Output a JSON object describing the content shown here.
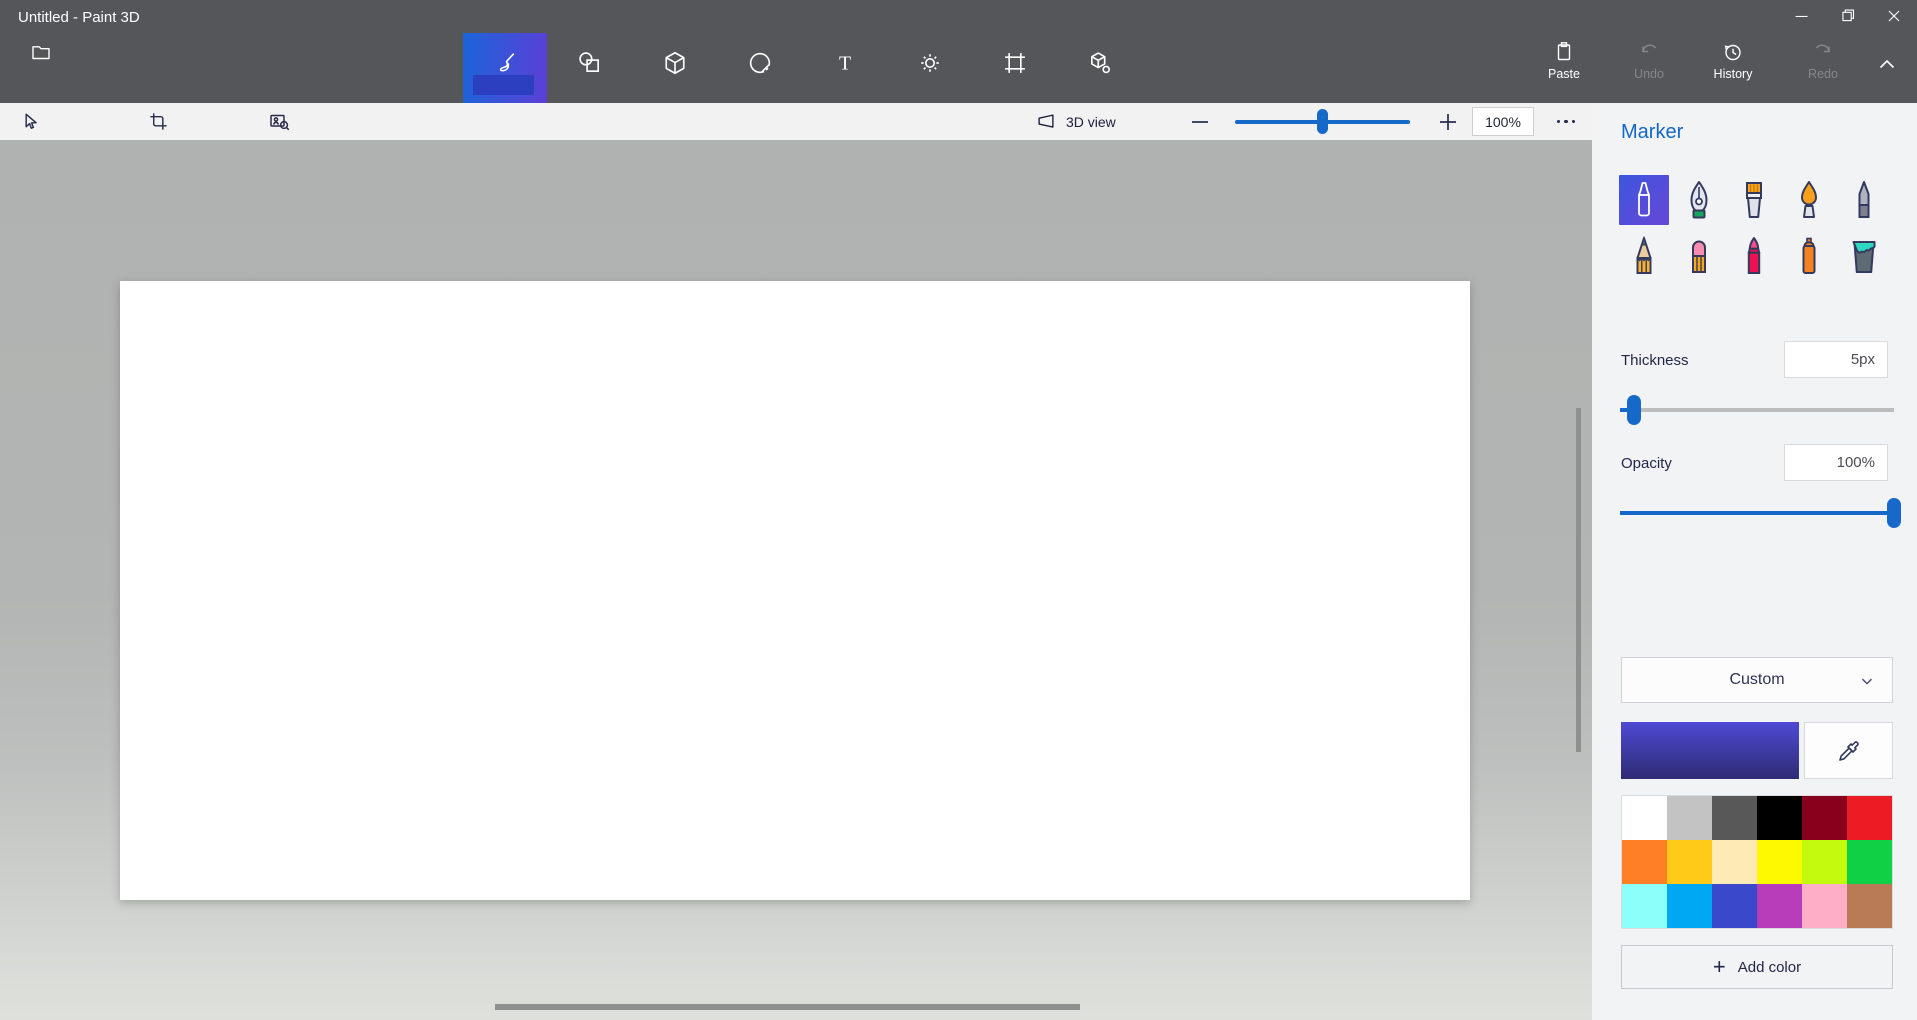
{
  "window": {
    "title": "Untitled - Paint 3D"
  },
  "header": {
    "menu_icon": "folder-menu-icon",
    "tools": [
      {
        "name": "brushes",
        "selected": true
      },
      {
        "name": "2d-shapes",
        "selected": false
      },
      {
        "name": "3d-shapes",
        "selected": false
      },
      {
        "name": "stickers",
        "selected": false
      },
      {
        "name": "text",
        "selected": false
      },
      {
        "name": "effects",
        "selected": false
      },
      {
        "name": "canvas",
        "selected": false
      },
      {
        "name": "3d-library",
        "selected": false
      }
    ],
    "actions": [
      {
        "label": "Paste",
        "enabled": true
      },
      {
        "label": "Undo",
        "enabled": false
      },
      {
        "label": "History",
        "enabled": true
      },
      {
        "label": "Redo",
        "enabled": false
      }
    ]
  },
  "toolbar": {
    "select_tools": [
      "select",
      "crop",
      "magic-select"
    ],
    "view_label": "3D view",
    "zoom_percent": "100%",
    "zoom_slider_percent": 50
  },
  "panel": {
    "title": "Marker",
    "brushes": [
      "marker",
      "calligraphy-pen",
      "oil-brush",
      "watercolor",
      "pixel-pen",
      "pencil",
      "eraser",
      "crayon",
      "spray-can",
      "fill"
    ],
    "selected_brush": "marker",
    "thickness": {
      "label": "Thickness",
      "value": "5px",
      "slider_percent": 5
    },
    "opacity": {
      "label": "Opacity",
      "value": "100%",
      "slider_percent": 100
    },
    "palette_dropdown": "Custom",
    "current_color": {
      "from": "#4e4ad4",
      "to": "#2e2b74"
    },
    "palette": [
      "#ffffff",
      "#c3c3c3",
      "#585858",
      "#000000",
      "#88001b",
      "#ec1c24",
      "#ff7f27",
      "#ffca18",
      "#fdeab5",
      "#fdf900",
      "#c3fa0e",
      "#0ed145",
      "#8cfffb",
      "#00a8f3",
      "#3a48cc",
      "#b83dba",
      "#ffaec8",
      "#b97a56"
    ],
    "add_color_label": "Add color"
  }
}
